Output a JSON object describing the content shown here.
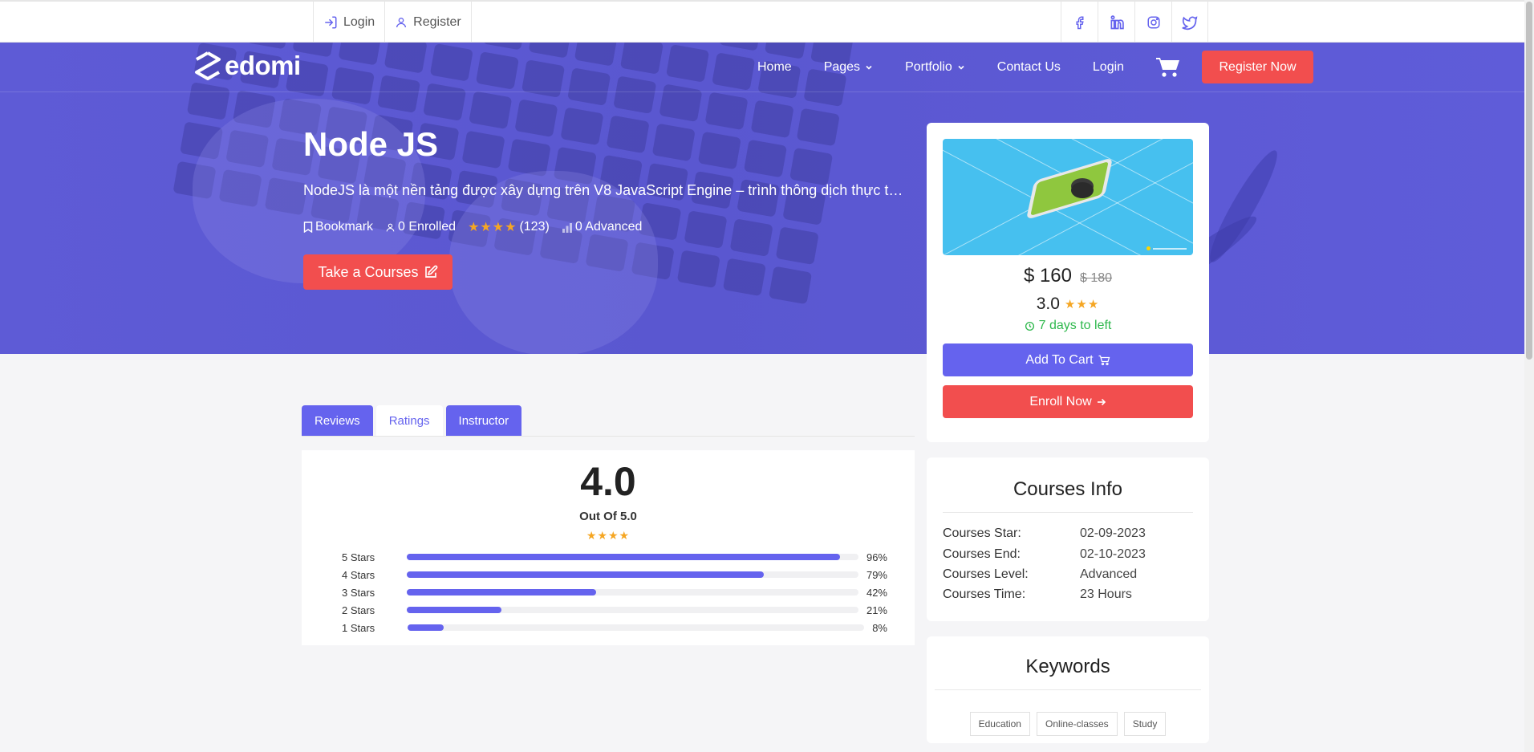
{
  "topbar": {
    "login": "Login",
    "register": "Register",
    "social": [
      "facebook-icon",
      "linkedin-icon",
      "instagram-icon",
      "twitter-icon"
    ]
  },
  "nav": {
    "logo": "edomi",
    "items": [
      "Home",
      "Pages",
      "Portfolio",
      "Contact Us",
      "Login"
    ],
    "register_button": "Register Now"
  },
  "hero": {
    "title": "Node JS",
    "description": "NodeJS là một nền tảng được xây dựng trên V8 JavaScript Engine – trình thông dịch thực thi mã JavaScript",
    "bookmark": "Bookmark",
    "enrolled": "0 Enrolled",
    "stars": "★★★★",
    "reviews": "(123)",
    "level": "0 Advanced",
    "cta": "Take a Courses"
  },
  "course_card": {
    "price": "$ 160",
    "old_price": "$ 180",
    "rating": "3.0",
    "stars": "★★★",
    "days_left": "7 days to left",
    "add_to_cart": "Add To Cart",
    "enroll": "Enroll Now"
  },
  "courses_info": {
    "title": "Courses Info",
    "rows": [
      {
        "label": "Courses Star:",
        "value": "02-09-2023"
      },
      {
        "label": "Courses End:",
        "value": "02-10-2023"
      },
      {
        "label": "Courses Level:",
        "value": "Advanced"
      },
      {
        "label": "Courses Time:",
        "value": "23 Hours"
      }
    ]
  },
  "keywords": {
    "title": "Keywords",
    "tags": [
      "Education",
      "Online-classes",
      "Study"
    ]
  },
  "tabs": [
    {
      "label": "Reviews",
      "active": false
    },
    {
      "label": "Ratings",
      "active": true
    },
    {
      "label": "Instructor",
      "active": false
    }
  ],
  "ratings": {
    "score": "4.0",
    "out_of": "Out Of 5.0",
    "stars": "★★★★",
    "bars": [
      {
        "label": "5 Stars",
        "percent": 96,
        "text": "96%"
      },
      {
        "label": "4 Stars",
        "percent": 79,
        "text": "79%"
      },
      {
        "label": "3 Stars",
        "percent": 42,
        "text": "42%"
      },
      {
        "label": "2 Stars",
        "percent": 21,
        "text": "21%"
      },
      {
        "label": "1 Stars",
        "percent": 8,
        "text": "8%"
      }
    ]
  },
  "colors": {
    "primary": "#6563ee",
    "accent": "#f24e4e",
    "star": "#f5a623",
    "success": "#2eb84c"
  }
}
